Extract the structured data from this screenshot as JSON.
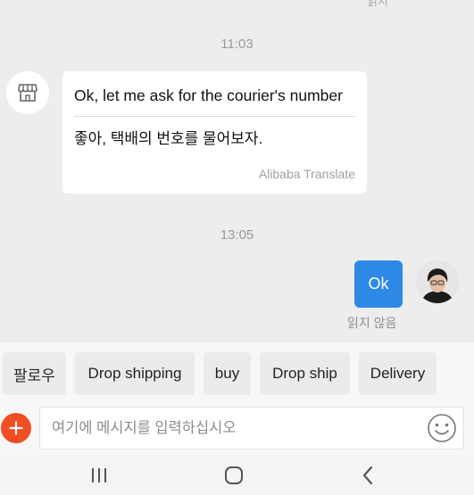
{
  "chat": {
    "cutoff_text": "읽지",
    "messages": [
      {
        "time": "11:03",
        "original": "Ok, let me ask for the courier's number",
        "translation": "좋아, 택배의 번호를 물어보자.",
        "translator": "Alibaba Translate"
      },
      {
        "time": "13:05",
        "text": "Ok",
        "status": "읽지 않음"
      }
    ]
  },
  "quick_replies": [
    "팔로우",
    "Drop shipping",
    "buy",
    "Drop ship",
    "Delivery"
  ],
  "composer": {
    "placeholder": "여기에 메시지를 입력하십시오",
    "value": ""
  },
  "icons": {
    "shop_avatar": "storefront-icon",
    "add": "plus-icon",
    "emoji": "smiley-icon",
    "nav": [
      "recent-apps-icon",
      "home-icon",
      "back-icon"
    ]
  },
  "colors": {
    "sent_bubble": "#2d88e6",
    "add_button": "#f04e23",
    "background": "#ededed"
  }
}
